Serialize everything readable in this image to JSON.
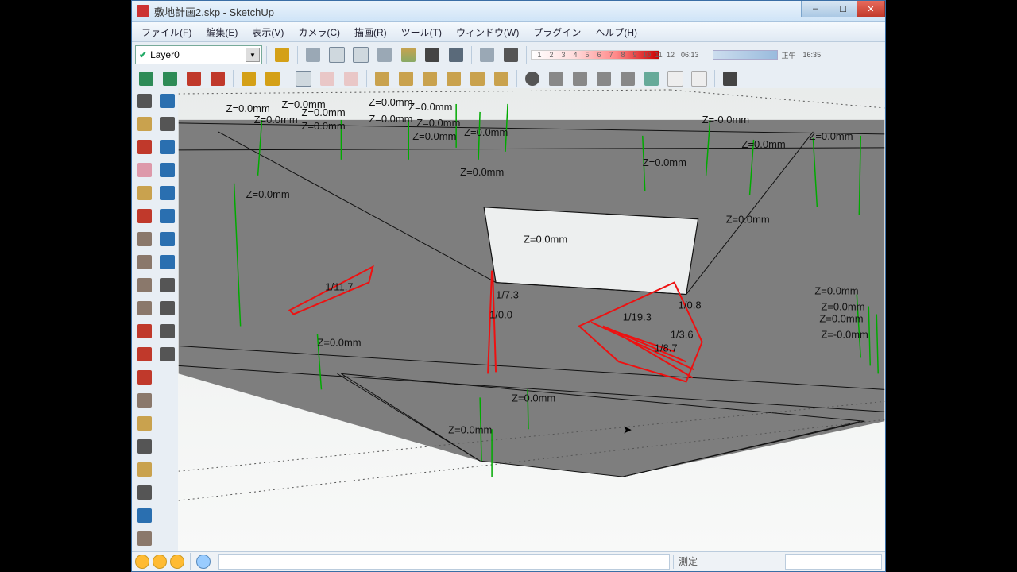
{
  "window": {
    "title": "敷地計画2.skp - SketchUp",
    "min_label": "–",
    "max_label": "☐",
    "close_label": "✕"
  },
  "menu": {
    "items": [
      "ファイル(F)",
      "編集(E)",
      "表示(V)",
      "カメラ(C)",
      "描画(R)",
      "ツール(T)",
      "ウィンドウ(W)",
      "プラグイン",
      "ヘルプ(H)"
    ]
  },
  "layer": {
    "selected": "Layer0"
  },
  "timescale": {
    "ticks": [
      "1",
      "2",
      "3",
      "4",
      "5",
      "6",
      "7",
      "8",
      "9",
      "10",
      "11",
      "12"
    ],
    "time1": "06:13",
    "noon": "正午",
    "time2": "16:35"
  },
  "status": {
    "label": "測定"
  },
  "annotations": {
    "z_default": "Z=0.0mm",
    "z_neg": "Z=-0.0mm",
    "z_minor": "Z=-0.0mm",
    "s_a": "1/11.7",
    "s_b": "1/7.3",
    "s_c": "1/0.0",
    "s_d": "1/0.8",
    "s_e": "1/19.3",
    "s_f": "1/3.6",
    "s_g": "1/8.7"
  },
  "left_tools": [
    "select-tool",
    "component-tool",
    "paint-bucket-tool",
    "eraser-tool",
    "rectangle-tool",
    "line-tool",
    "circle-tool",
    "arc-tool",
    "polygon-tool",
    "freehand-tool",
    "move-tool",
    "rotate-tool",
    "scale-tool",
    "offset-tool",
    "pushpull-tool",
    "followme-tool",
    "tape-tool",
    "protractor-tool",
    "dimension-tool",
    "text-tool",
    "axes-tool",
    "3dtext-tool",
    "orbit-tool",
    "pan-tool",
    "zoom-tool",
    "zoomextents-tool",
    "previous-tool",
    "next-tool",
    "position-camera-tool",
    "lookaround-tool",
    "walk-tool",
    "section-tool"
  ],
  "top_tools_row1": [
    "layers-icon",
    "iso-icon",
    "wireframe-icon",
    "hidden-icon",
    "shaded-icon",
    "shadedtex-icon",
    "mono-icon",
    "xray-icon",
    "sep",
    "shadow-icon",
    "shadow2-icon"
  ],
  "top_tools_row2": [
    "sandbox-grid-icon",
    "sandbox-scratch-icon",
    "smoove-icon",
    "stamp-icon",
    "drape-icon",
    "detail-icon",
    "flip-icon",
    "sep",
    "section-display-icon",
    "section-cut-icon",
    "sep",
    "house1-icon",
    "house2-icon",
    "house3-icon",
    "house4-icon",
    "house5-icon",
    "house6-icon",
    "sep",
    "search-icon",
    "style1-icon",
    "style2-icon",
    "style3-icon",
    "style4-icon",
    "style5-icon",
    "style6-icon",
    "style7-icon",
    "sep",
    "plugin-icon"
  ],
  "colors": {
    "tool_generic": "#7a8a99",
    "tool_red": "#c0392b",
    "tool_yellow": "#d4a017",
    "tool_green": "#2e8b57",
    "tool_blue": "#2a6fb0",
    "tool_cube": "#9aa8b5"
  }
}
